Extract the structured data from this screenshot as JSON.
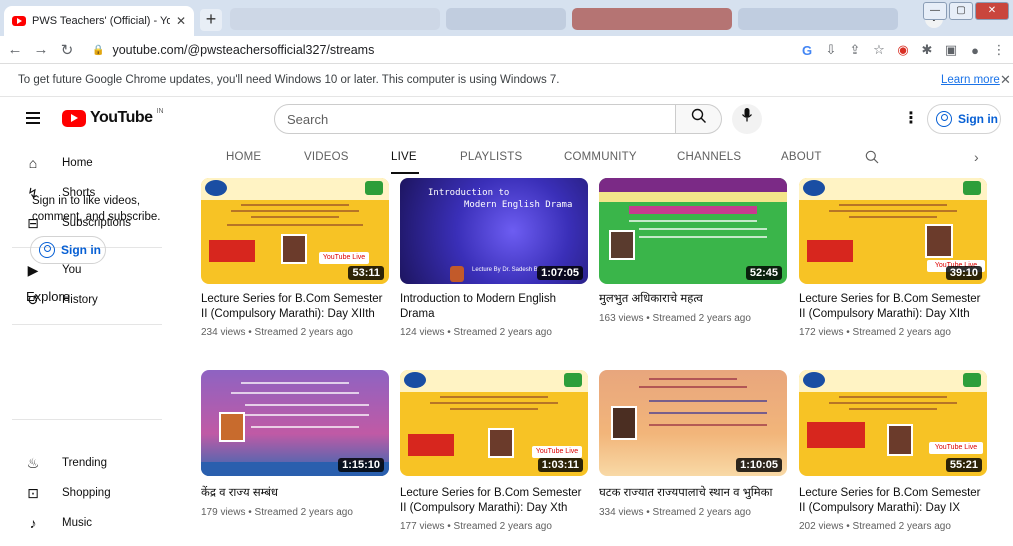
{
  "browser": {
    "tab_title": "PWS Teachers' (Official) - YouTub",
    "url": "youtube.com/@pwsteachersofficial327/streams",
    "infobar_message": "To get future Google Chrome updates, you'll need Windows 10 or later. This computer is using Windows 7.",
    "infobar_link": "Learn more"
  },
  "header": {
    "logo_text": "YouTube",
    "country_code": "IN",
    "search_placeholder": "Search",
    "signin_label": "Sign in"
  },
  "sidebar": {
    "items": [
      {
        "label": "Home",
        "icon": "home-icon"
      },
      {
        "label": "Shorts",
        "icon": "shorts-icon"
      },
      {
        "label": "Subscriptions",
        "icon": "subscriptions-icon"
      },
      {
        "label": "You",
        "icon": "you-icon"
      },
      {
        "label": "History",
        "icon": "history-icon"
      }
    ],
    "signin_prompt": "Sign in to like videos, comment, and subscribe.",
    "signin_label": "Sign in",
    "explore_heading": "Explore",
    "explore_items": [
      {
        "label": "Trending",
        "icon": "trending-icon"
      },
      {
        "label": "Shopping",
        "icon": "shopping-icon"
      },
      {
        "label": "Music",
        "icon": "music-icon"
      }
    ]
  },
  "channel_tabs": [
    "HOME",
    "VIDEOS",
    "LIVE",
    "PLAYLISTS",
    "COMMUNITY",
    "CHANNELS",
    "ABOUT"
  ],
  "active_tab": "LIVE",
  "videos": [
    {
      "title": "Lecture Series for B.Com Semester II (Compulsory Marathi): Day XIIth",
      "meta": "234 views • Streamed 2 years ago",
      "duration": "53:11"
    },
    {
      "title": "Introduction to Modern English Drama",
      "meta": "124 views • Streamed 2 years ago",
      "duration": "1:07:05"
    },
    {
      "title": "मुलभुत अधिकाराचे महत्व",
      "meta": "163 views • Streamed 2 years ago",
      "duration": "52:45"
    },
    {
      "title": "Lecture Series for B.Com Semester II (Compulsory Marathi): Day XIth",
      "meta": "172 views • Streamed 2 years ago",
      "duration": "39:10"
    },
    {
      "title": "केंद्र व राज्य सम्बंध",
      "meta": "179 views • Streamed 2 years ago",
      "duration": "1:15:10"
    },
    {
      "title": "Lecture Series for B.Com Semester II (Compulsory Marathi): Day Xth",
      "meta": "177 views • Streamed 2 years ago",
      "duration": "1:03:11"
    },
    {
      "title": "घटक राज्यात राज्यपालाचे स्थान व भुमिका",
      "meta": "334 views • Streamed 2 years ago",
      "duration": "1:10:05"
    },
    {
      "title": "Lecture Series for B.Com Semester II (Compulsory Marathi): Day IX",
      "meta": "202 views • Streamed 2 years ago",
      "duration": "55:21"
    }
  ],
  "thumb_text": {
    "drama_title_1": "Introduction to",
    "drama_title_2": "Modern English Drama",
    "drama_credit": "Lecture By Dr. Sadesh B. G",
    "youtube_live": "YouTube Live",
    "live_word": "Live"
  }
}
